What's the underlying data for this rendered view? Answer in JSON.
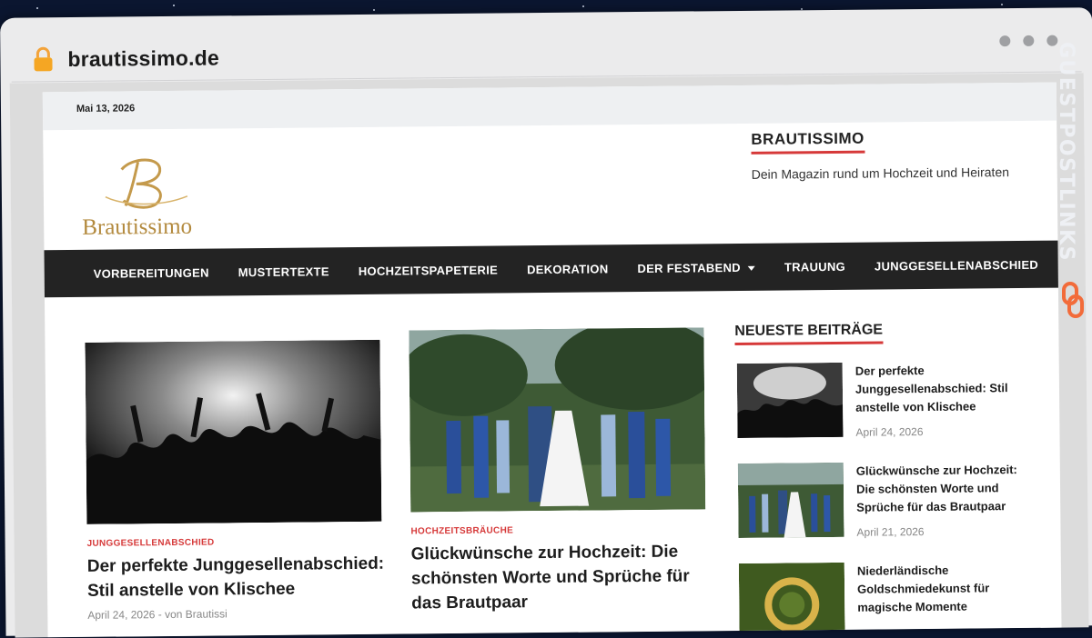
{
  "browser": {
    "url": "brautissimo.de",
    "badge": "GUESTPOSTLINKS"
  },
  "topbar": {
    "date": "Mai 13, 2026"
  },
  "header": {
    "logo_text": "Brautissimo",
    "site_title": "BRAUTISSIMO",
    "site_description": "Dein Magazin rund um Hochzeit und Heiraten"
  },
  "nav": {
    "items": [
      "VORBEREITUNGEN",
      "MUSTERTEXTE",
      "HOCHZEITSPAPETERIE",
      "DEKORATION",
      "DER FESTABEND",
      "TRAUUNG",
      "JUNGGESELLENABSCHIED"
    ]
  },
  "posts": [
    {
      "category": "JUNGGESELLENABSCHIED",
      "title": "Der perfekte Junggesellenabschied: Stil anstelle von Klischee",
      "date": "April 24, 2026",
      "author": "von Brautissi"
    },
    {
      "category": "HOCHZEITSBRÄUCHE",
      "title": "Glückwünsche zur Hochzeit: Die schönsten Worte und Sprüche für das Brautpaar"
    }
  ],
  "sidebar": {
    "title": "NEUESTE BEITRÄGE",
    "items": [
      {
        "title": "Der perfekte Junggesellenabschied: Stil anstelle von Klischee",
        "date": "April 24, 2026"
      },
      {
        "title": "Glückwünsche zur Hochzeit: Die schönsten Worte und Sprüche für das Brautpaar",
        "date": "April 21, 2026"
      },
      {
        "title": "Niederländische Goldschmiedekunst für magische Momente"
      }
    ]
  },
  "colors": {
    "accent": "#d63939",
    "nav_bg": "#232323",
    "logo_gold": "#b38a3e",
    "badge_orange": "#f26b3a"
  },
  "icons": [
    "lock-icon",
    "search-icon",
    "chevron-down-icon",
    "chain-link-icon"
  ]
}
